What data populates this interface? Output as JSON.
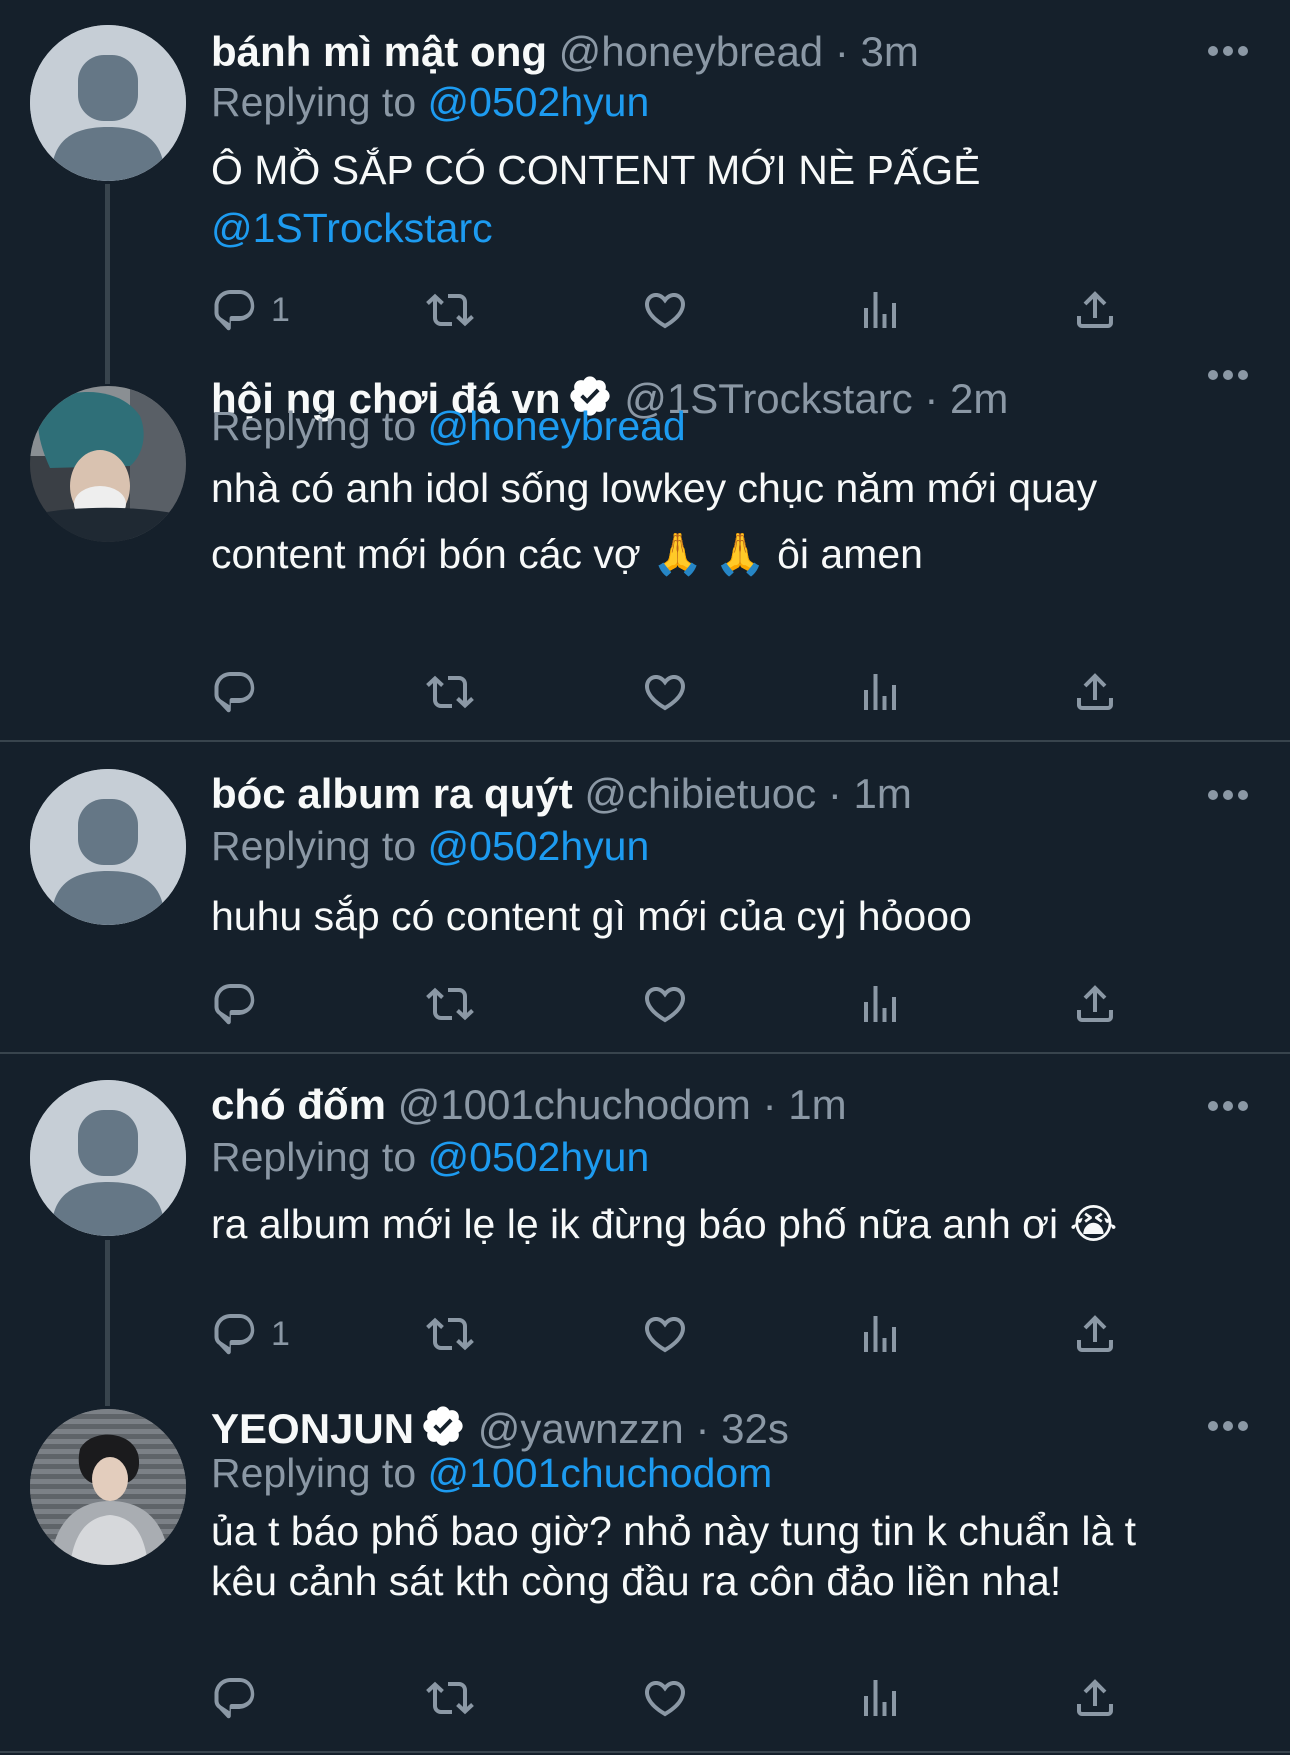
{
  "colors": {
    "background": "#15202b",
    "text": "#f7f9f9",
    "muted": "#8b98a5",
    "link": "#1d9bf0",
    "divider": "#38444d"
  },
  "icons": {
    "reply": "reply-icon",
    "retweet": "retweet-icon",
    "like": "heart-icon",
    "views": "views-icon",
    "share": "share-icon",
    "more": "more-icon",
    "verified": "verified-badge-icon"
  },
  "replying_label": "Replying to",
  "tweets": [
    {
      "name": "bánh mì mật ong",
      "verified": false,
      "handle": "@honeybread",
      "time": "3m",
      "reply_to": "@0502hyun",
      "text": "Ô MỒ SẮP CÓ CONTENT MỚI NÈ PẤGẺ",
      "mention": "@1STrockstarc",
      "reply_count": "1",
      "avatar": "default"
    },
    {
      "name": "hội ng chơi đá vn",
      "verified": true,
      "handle": "@1STrockstarc",
      "time": "2m",
      "reply_to": "@honeybread",
      "text_line1": "nhà có anh idol sống lowkey chục năm mới quay",
      "text_line2": "content mới bón các vợ 🙏 🙏  ôi amen",
      "reply_count": "",
      "avatar": "photo"
    },
    {
      "name": "bóc album ra quýt",
      "verified": false,
      "handle": "@chibietuoc",
      "time": "1m",
      "reply_to": "@0502hyun",
      "text": "huhu sắp có content gì mới của cyj hỏooo",
      "reply_count": "",
      "avatar": "default"
    },
    {
      "name": "chó đốm",
      "verified": false,
      "handle": "@1001chuchodom",
      "time": "1m",
      "reply_to": "@0502hyun",
      "text": "ra album mới lẹ lẹ ik đừng báo phố nữa anh ơi 😭",
      "reply_count": "1",
      "avatar": "default"
    },
    {
      "name": "YEONJUN",
      "verified": true,
      "handle": "@yawnzzn",
      "time": "32s",
      "reply_to": "@1001chuchodom",
      "text_line1": "ủa t báo phố bao giờ? nhỏ này tung tin k chuẩn là t",
      "text_line2": "kêu cảnh sát kth còng đầu ra côn đảo liền nha!",
      "reply_count": "",
      "avatar": "photo"
    }
  ]
}
